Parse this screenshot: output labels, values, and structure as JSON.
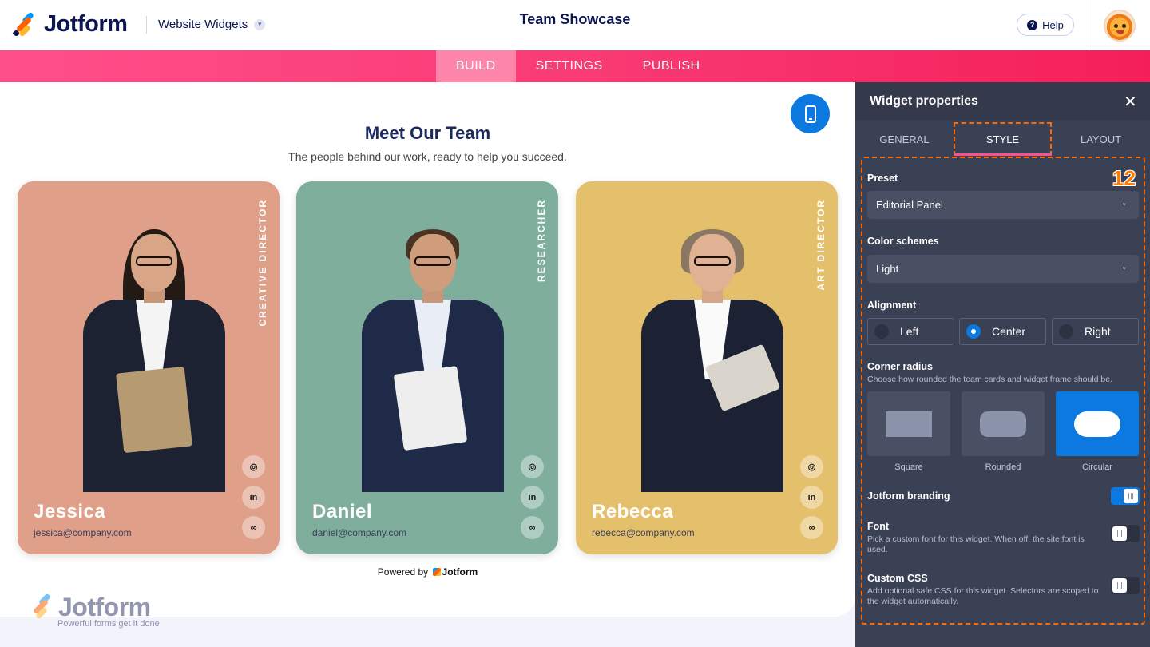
{
  "header": {
    "brand": "Jotform",
    "product": "Website Widgets",
    "title": "Team Showcase",
    "help": "Help"
  },
  "nav": {
    "tabs": [
      {
        "label": "BUILD",
        "active": true
      },
      {
        "label": "SETTINGS",
        "active": false
      },
      {
        "label": "PUBLISH",
        "active": false
      }
    ]
  },
  "widget": {
    "title": "Meet Our Team",
    "subtitle": "The people behind our work, ready to help you succeed.",
    "cards": [
      {
        "name": "Jessica",
        "email": "jessica@company.com",
        "role": "CREATIVE DIRECTOR",
        "color": "#df9f88"
      },
      {
        "name": "Daniel",
        "email": "daniel@company.com",
        "role": "RESEARCHER",
        "color": "#7fae9d"
      },
      {
        "name": "Rebecca",
        "email": "rebecca@company.com",
        "role": "ART DIRECTOR",
        "color": "#e5c06c"
      }
    ],
    "powered_prefix": "Powered by",
    "powered_brand": "Jotform"
  },
  "watermark": {
    "brand": "Jotform",
    "tagline": "Powerful forms get it done"
  },
  "panel": {
    "title": "Widget properties",
    "tabs": [
      {
        "label": "GENERAL",
        "active": false
      },
      {
        "label": "STYLE",
        "active": true
      },
      {
        "label": "LAYOUT",
        "active": false
      }
    ],
    "step_badge": "12",
    "preset": {
      "label": "Preset",
      "value": "Editorial Panel"
    },
    "color_scheme": {
      "label": "Color schemes",
      "value": "Light"
    },
    "alignment": {
      "label": "Alignment",
      "options": [
        {
          "label": "Left",
          "selected": false
        },
        {
          "label": "Center",
          "selected": true
        },
        {
          "label": "Right",
          "selected": false
        }
      ]
    },
    "corner_radius": {
      "label": "Corner radius",
      "description": "Choose how rounded the team cards and widget frame should be.",
      "options": [
        {
          "label": "Square",
          "selected": false
        },
        {
          "label": "Rounded",
          "selected": false
        },
        {
          "label": "Circular",
          "selected": true
        }
      ]
    },
    "branding": {
      "label": "Jotform branding",
      "on": true
    },
    "font": {
      "label": "Font",
      "description": "Pick a custom font for this widget. When off, the site font is used.",
      "on": false
    },
    "custom_css": {
      "label": "Custom CSS",
      "description": "Add optional safe CSS for this widget. Selectors are scoped to the widget automatically.",
      "on": false
    }
  },
  "colors": {
    "accent": "#0b79e0",
    "nav_pink": "#f93b74",
    "panel_bg": "#3b4154",
    "highlight": "#ff6a00"
  }
}
